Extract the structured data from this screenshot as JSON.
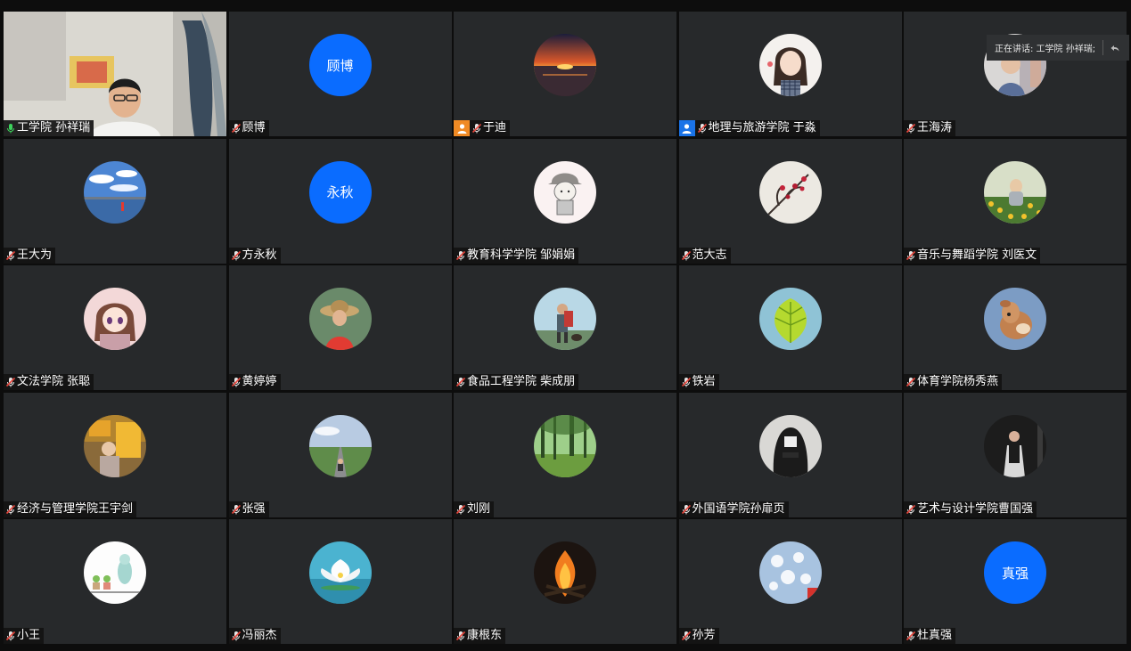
{
  "speaking_indicator": {
    "label": "正在讲话: 工学院 孙祥瑞;"
  },
  "participants": [
    {
      "name": "工学院 孙祥瑞",
      "kind": "video",
      "mic": "active"
    },
    {
      "name": "顾博",
      "kind": "initial",
      "initial": "顾博",
      "mic": "muted"
    },
    {
      "name": "于迪",
      "kind": "photo",
      "photo": "sunset",
      "role": "host",
      "mic": "muted"
    },
    {
      "name": "地理与旅游学院 于淼",
      "kind": "photo",
      "photo": "girl-illustration",
      "role": "cohost",
      "mic": "muted"
    },
    {
      "name": "王海涛",
      "kind": "photo",
      "photo": "person-portrait",
      "mic": "muted"
    },
    {
      "name": "王大为",
      "kind": "photo",
      "photo": "sky-lake",
      "mic": "muted"
    },
    {
      "name": "方永秋",
      "kind": "initial",
      "initial": "永秋",
      "mic": "muted"
    },
    {
      "name": "教育科学学院  邹娟娟",
      "kind": "photo",
      "photo": "cartoon-boy",
      "mic": "muted"
    },
    {
      "name": "范大志",
      "kind": "photo",
      "photo": "plum-blossom",
      "mic": "muted"
    },
    {
      "name": "音乐与舞蹈学院 刘医文",
      "kind": "photo",
      "photo": "child-flowers",
      "mic": "muted"
    },
    {
      "name": "文法学院 张聪",
      "kind": "photo",
      "photo": "anime-girl",
      "mic": "muted"
    },
    {
      "name": "黄婷婷",
      "kind": "photo",
      "photo": "woman-hat",
      "mic": "muted"
    },
    {
      "name": "食品工程学院 柴成朋",
      "kind": "photo",
      "photo": "hiker-dog",
      "mic": "muted"
    },
    {
      "name": "铁岩",
      "kind": "photo",
      "photo": "green-leaf",
      "mic": "muted"
    },
    {
      "name": "体育学院杨秀燕",
      "kind": "photo",
      "photo": "fawn",
      "mic": "muted"
    },
    {
      "name": "经济与管理学院王宇剑",
      "kind": "photo",
      "photo": "child-truck",
      "mic": "muted"
    },
    {
      "name": "张强",
      "kind": "photo",
      "photo": "road-grassland",
      "mic": "muted"
    },
    {
      "name": "刘刚",
      "kind": "photo",
      "photo": "forest",
      "mic": "muted"
    },
    {
      "name": "外国语学院孙扉页",
      "kind": "photo",
      "photo": "hooded-figure",
      "mic": "muted"
    },
    {
      "name": "艺术与设计学院曹国强",
      "kind": "photo",
      "photo": "speaker-stage",
      "mic": "muted"
    },
    {
      "name": "小王",
      "kind": "photo",
      "photo": "cute-plants",
      "mic": "muted"
    },
    {
      "name": "冯丽杰",
      "kind": "photo",
      "photo": "lotus",
      "mic": "muted"
    },
    {
      "name": "康根东",
      "kind": "photo",
      "photo": "bonfire",
      "mic": "muted"
    },
    {
      "name": "孙芳",
      "kind": "photo",
      "photo": "white-flowers",
      "mic": "muted"
    },
    {
      "name": "杜真强",
      "kind": "initial",
      "initial": "真强",
      "mic": "muted"
    }
  ],
  "colors": {
    "tile_bg": "#27292b",
    "initial_avatar_bg": "#0a6cff",
    "host_badge": "#f08a24",
    "cohost_badge": "#1a73e8",
    "mic_active": "#3dd35c",
    "mic_muted_slash": "#e8463c"
  }
}
